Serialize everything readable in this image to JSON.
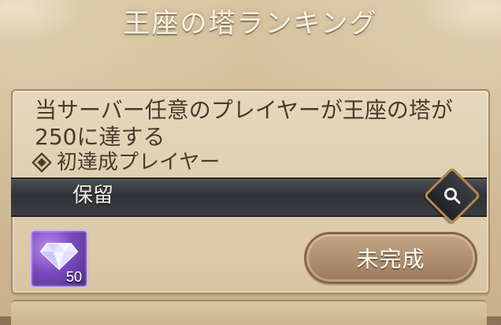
{
  "title": "王座の塔ランキング",
  "mission": {
    "description_line1": "当サーバー任意のプレイヤーが王座の塔が",
    "description_line2": "250に達する",
    "subtitle": "初達成プレイヤー"
  },
  "status": {
    "text": "保留"
  },
  "reward": {
    "count": "50",
    "icon": "diamond-gem-icon",
    "accent_color": "#7b4bc2"
  },
  "action": {
    "incomplete_label": "未完成"
  },
  "colors": {
    "panel": "#e6d8bd",
    "status_bar": "#2f3236",
    "button": "#a98664",
    "title_text": "#f6f1e6",
    "body_text": "#4b3a2b",
    "gold_accent": "#b08a48"
  }
}
